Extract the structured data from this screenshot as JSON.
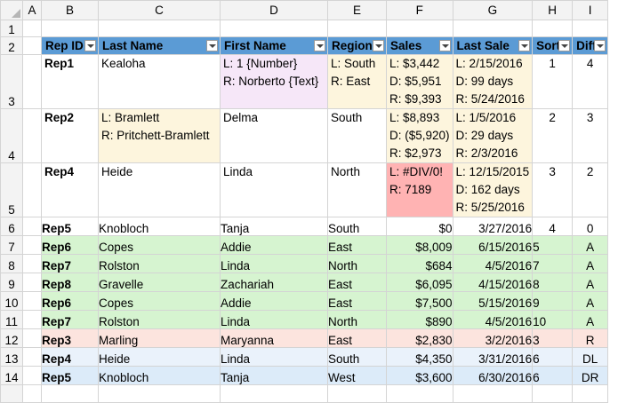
{
  "columns": [
    "A",
    "B",
    "C",
    "D",
    "E",
    "F",
    "G",
    "H",
    "I"
  ],
  "rows": [
    "1",
    "2",
    "3",
    "4",
    "5",
    "6",
    "7",
    "8",
    "9",
    "10",
    "11",
    "12",
    "13",
    "14"
  ],
  "headers": {
    "rep_id": "Rep ID",
    "last": "Last Name",
    "first": "First Name",
    "region": "Region",
    "sales": "Sales",
    "last_sale": "Last Sale",
    "sort": "Sort",
    "diff": "Diff"
  },
  "r3": {
    "rep": "Rep1",
    "last": "Kealoha",
    "first": [
      "L: 1 {Number}",
      "R: Norberto {Text}"
    ],
    "region": [
      "L: South",
      "R: East"
    ],
    "sales": [
      "L: $3,442",
      "D: $5,951",
      "R: $9,393"
    ],
    "date": [
      "L: 2/15/2016",
      "D: 99 days",
      "R: 5/24/2016"
    ],
    "sort": "1",
    "diff": "4"
  },
  "r4": {
    "rep": "Rep2",
    "last": [
      "L: Bramlett",
      "R: Pritchett-Bramlett"
    ],
    "first": "Delma",
    "region": "South",
    "sales": [
      "L: $8,893",
      "D: ($5,920)",
      "R: $2,973"
    ],
    "date": [
      "L: 1/5/2016",
      "D: 29 days",
      "R: 2/3/2016"
    ],
    "sort": "2",
    "diff": "3"
  },
  "r5": {
    "rep": "Rep4",
    "last": "Heide",
    "first": "Linda",
    "region": "North",
    "sales": [
      "L: #DIV/0!",
      "R: 7189"
    ],
    "date": [
      "L: 12/15/2015",
      "D: 162 days",
      "R: 5/25/2016"
    ],
    "sort": "3",
    "diff": "2"
  },
  "data_rows": [
    {
      "rep": "Rep5",
      "last": "Knobloch",
      "first": "Tanja",
      "region": "South",
      "sales": "$0",
      "date": "3/27/2016",
      "sort": "4",
      "diff": "0"
    },
    {
      "rep": "Rep6",
      "last": "Copes",
      "first": "Addie",
      "region": "East",
      "sales": "$8,009",
      "date": "6/15/2016",
      "sort": "5",
      "diff": "A"
    },
    {
      "rep": "Rep7",
      "last": "Rolston",
      "first": "Linda",
      "region": "North",
      "sales": "$684",
      "date": "4/5/2016",
      "sort": "7",
      "diff": "A"
    },
    {
      "rep": "Rep8",
      "last": "Gravelle",
      "first": "Zachariah",
      "region": "East",
      "sales": "$6,095",
      "date": "4/15/2016",
      "sort": "8",
      "diff": "A"
    },
    {
      "rep": "Rep6",
      "last": "Copes",
      "first": "Addie",
      "region": "East",
      "sales": "$7,500",
      "date": "5/15/2016",
      "sort": "9",
      "diff": "A"
    },
    {
      "rep": "Rep7",
      "last": "Rolston",
      "first": "Linda",
      "region": "North",
      "sales": "$890",
      "date": "4/5/2016",
      "sort": "10",
      "diff": "A"
    },
    {
      "rep": "Rep3",
      "last": "Marling",
      "first": "Maryanna",
      "region": "East",
      "sales": "$2,830",
      "date": "3/2/2016",
      "sort": "3",
      "diff": "R"
    },
    {
      "rep": "Rep4",
      "last": "Heide",
      "first": "Linda",
      "region": "South",
      "sales": "$4,350",
      "date": "3/31/2016",
      "sort": "6",
      "diff": "DL"
    },
    {
      "rep": "Rep5",
      "last": "Knobloch",
      "first": "Tanja",
      "region": "West",
      "sales": "$3,600",
      "date": "6/30/2016",
      "sort": "6",
      "diff": "DR"
    }
  ],
  "colors": {
    "header": "#5b9bd5",
    "added": "#d6f4d0",
    "removed": "#fce4de",
    "diff_left": "#eaf2fb",
    "diff_right": "#dcebf9",
    "changed": "#fdf5dd",
    "type_change": "#f6e7f8",
    "error": "#ffb3b3"
  }
}
